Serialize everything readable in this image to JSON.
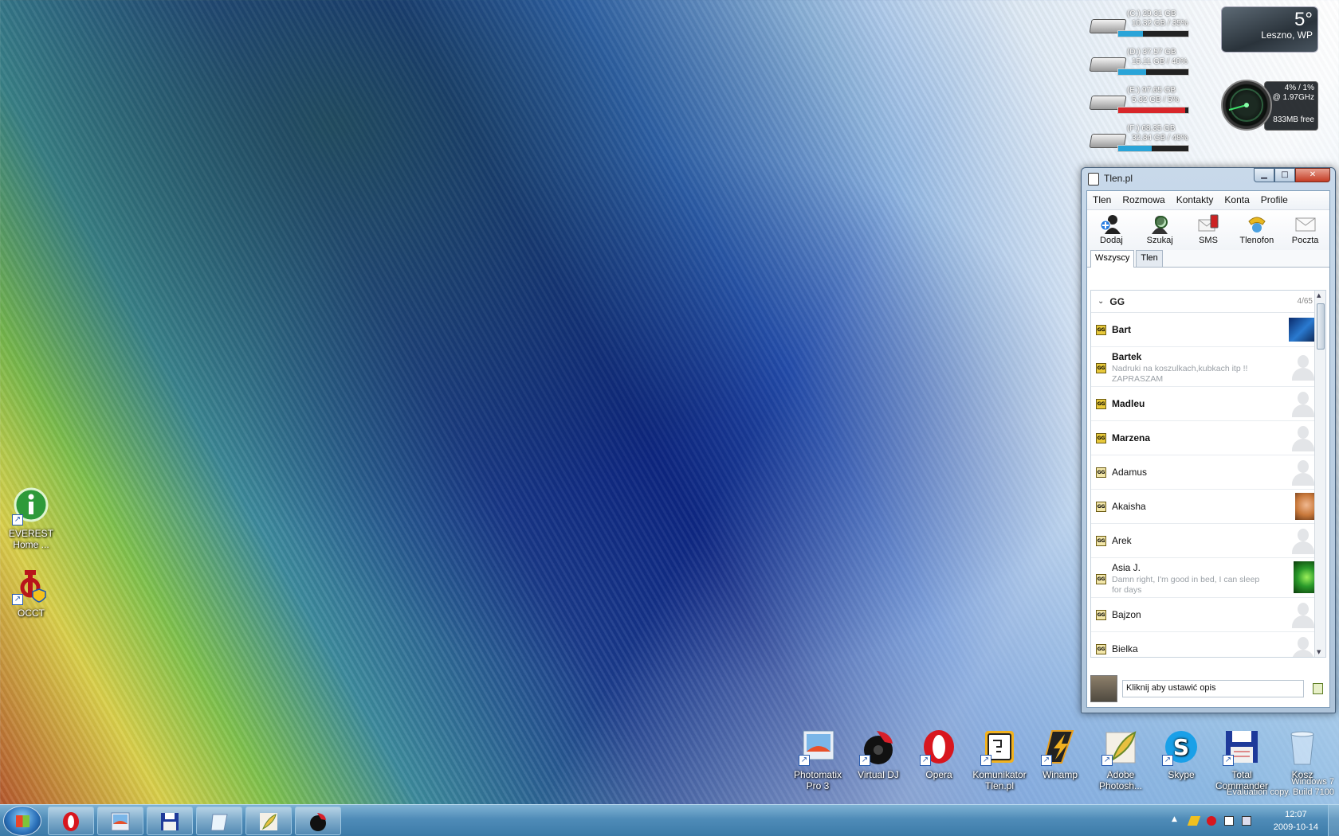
{
  "desktop_icons": [
    {
      "label_line1": "EVEREST",
      "label_line2": "Home ..."
    },
    {
      "label_line1": "OCCT",
      "label_line2": ""
    }
  ],
  "drives": [
    {
      "line1": "(C:) 29.31 GB",
      "line2": "10.32 GB / 35%",
      "percent": 35,
      "color": "#2aa4d8"
    },
    {
      "line1": "(D:) 37.57 GB",
      "line2": "15.11 GB / 40%",
      "percent": 40,
      "color": "#2aa4d8"
    },
    {
      "line1": "(E:) 97.65 GB",
      "line2": "5.32 GB / 5%",
      "percent": 95,
      "color": "#d8262a"
    },
    {
      "line1": "(F:) 68.35 GB",
      "line2": "32.84 GB / 48%",
      "percent": 48,
      "color": "#2aa4d8"
    }
  ],
  "weather": {
    "temp": "5°",
    "location": "Leszno, WP"
  },
  "cpu": {
    "usage": "4% /   1%",
    "freq": "@ 1.97GHz",
    "mem": "833MB free"
  },
  "tlen": {
    "title": "Tlen.pl",
    "menu": [
      "Tlen",
      "Rozmowa",
      "Kontakty",
      "Konta",
      "Profile"
    ],
    "toolbar": [
      "Dodaj",
      "Szukaj",
      "SMS",
      "Tlenofon",
      "Poczta"
    ],
    "tabs": [
      "Wszyscy",
      "Tlen"
    ],
    "group": {
      "name": "GG",
      "count": "4/65"
    },
    "contacts": [
      {
        "name": "Bart",
        "desc": "",
        "bold": true,
        "avatar": "photo-blue"
      },
      {
        "name": "Bartek",
        "desc": "Nadruki na koszulkach,kubkach itp !! ZAPRASZAM",
        "bold": true,
        "avatar": "silhouette"
      },
      {
        "name": "Madleu",
        "desc": "",
        "bold": true,
        "avatar": "silhouette"
      },
      {
        "name": "Marzena",
        "desc": "",
        "bold": true,
        "avatar": "silhouette"
      },
      {
        "name": "Adamus",
        "desc": "",
        "bold": false,
        "avatar": "silhouette"
      },
      {
        "name": "Akaisha",
        "desc": "",
        "bold": false,
        "avatar": "photo-face"
      },
      {
        "name": "Arek",
        "desc": "",
        "bold": false,
        "avatar": "silhouette"
      },
      {
        "name": "Asia J.",
        "desc": "Damn right, I'm good in bed, I can sleep for days",
        "bold": false,
        "avatar": "photo-green"
      },
      {
        "name": "Bajzon",
        "desc": "",
        "bold": false,
        "avatar": "silhouette"
      },
      {
        "name": "Bielka",
        "desc": "",
        "bold": false,
        "avatar": "silhouette"
      }
    ],
    "status_placeholder": "Kliknij aby ustawić opis"
  },
  "shortcuts": [
    {
      "line1": "Photomatix",
      "line2": "Pro 3",
      "icon": "photomatix-icon"
    },
    {
      "line1": "Virtual DJ",
      "line2": "",
      "icon": "virtualdj-icon"
    },
    {
      "line1": "Opera",
      "line2": "",
      "icon": "opera-icon"
    },
    {
      "line1": "Komunikator",
      "line2": "Tlen.pl",
      "icon": "tlen-icon"
    },
    {
      "line1": "Winamp",
      "line2": "",
      "icon": "winamp-icon"
    },
    {
      "line1": "Adobe",
      "line2": "Photosh...",
      "icon": "photoshop-icon"
    },
    {
      "line1": "Skype",
      "line2": "",
      "icon": "skype-icon"
    },
    {
      "line1": "Total",
      "line2": "Commander",
      "icon": "totalcommander-icon"
    },
    {
      "line1": "Kosz",
      "line2": "",
      "icon": "recycle-bin-icon"
    }
  ],
  "watermark": {
    "line1": "Windows 7",
    "line2": "Evaluation copy. Build 7100"
  },
  "taskbar": {
    "buttons": [
      "opera-icon",
      "photomatix-icon",
      "totalcommander-icon",
      "notepad-icon",
      "photoshop-icon",
      "virtualdj-icon"
    ],
    "time": "12:07",
    "date": "2009-10-14"
  }
}
